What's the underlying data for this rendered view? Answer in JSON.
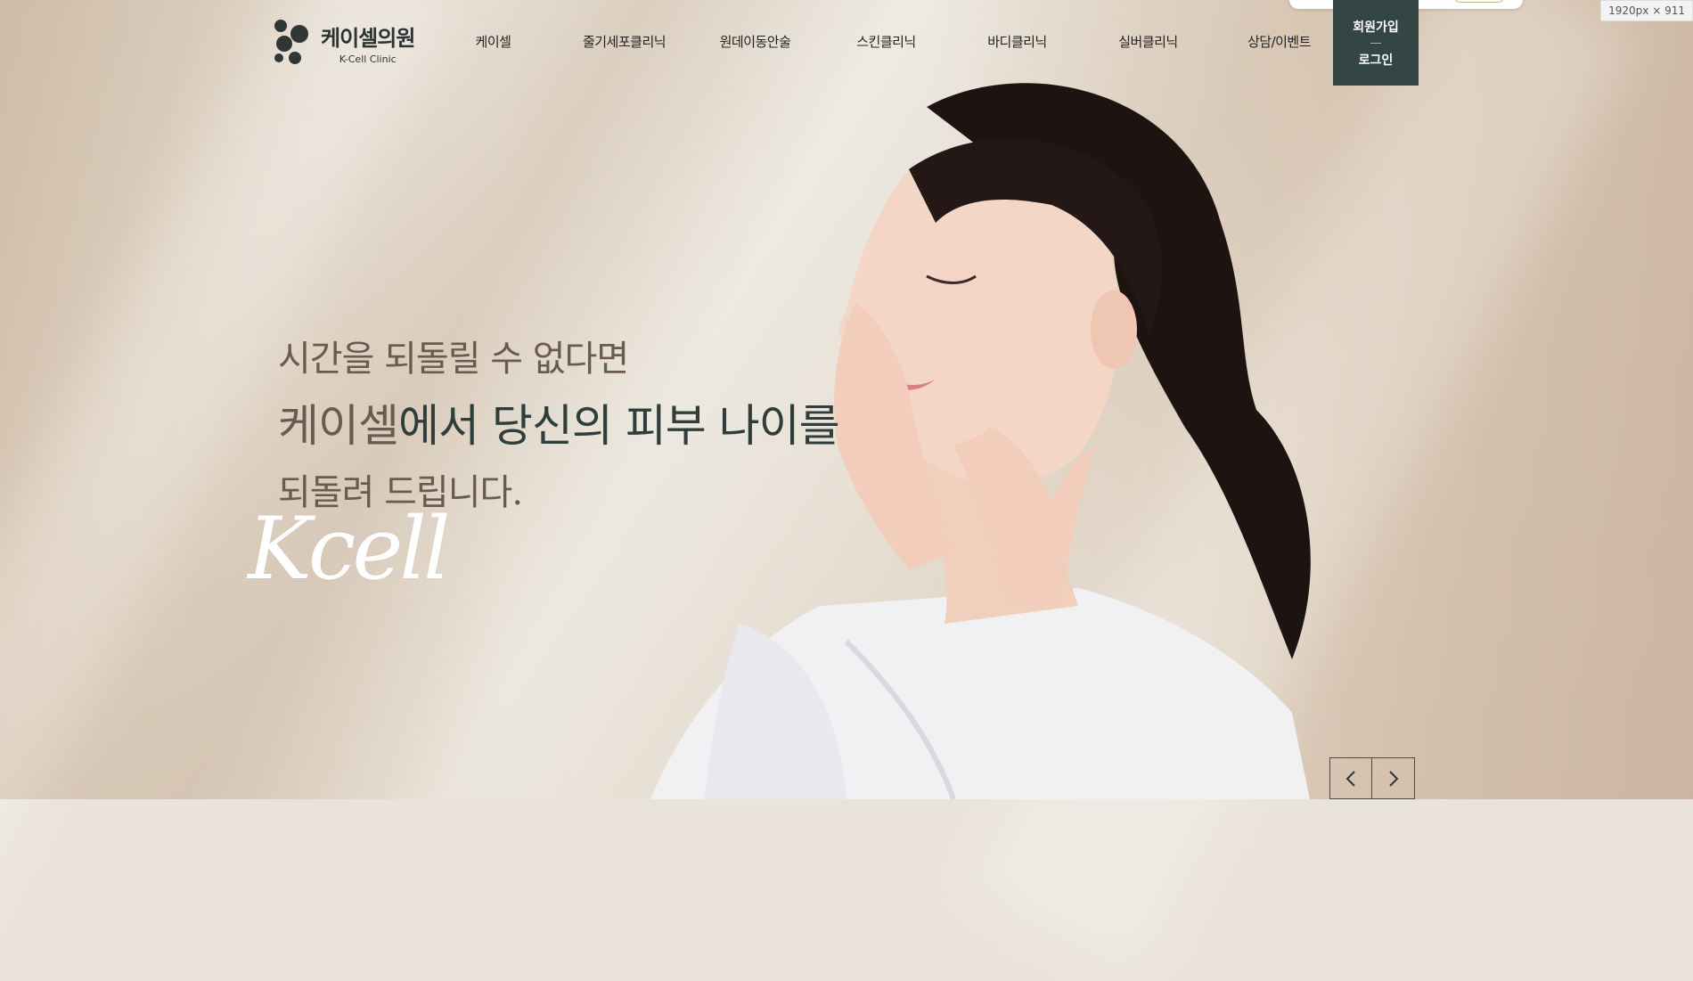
{
  "header": {
    "logo": {
      "name": "케이셀의원",
      "sub": "K-Cell Clinic"
    },
    "nav": [
      {
        "label": "케이셀"
      },
      {
        "label": "줄기세포클리닉"
      },
      {
        "label": "원데이동안술"
      },
      {
        "label": "스킨클리닉"
      },
      {
        "label": "바디클리닉"
      },
      {
        "label": "실버클리닉"
      },
      {
        "label": "상담/이벤트"
      }
    ],
    "member": {
      "signup": "회원가입",
      "sep": "—",
      "login": "로그인"
    }
  },
  "viewport_badge": "1920px × 911",
  "hero": {
    "line1": "시간을 되돌릴 수 없다면",
    "line2_a": "케이셀",
    "line2_b": "에서 당신의 피부 나이를",
    "line3": "되돌려 드립니다.",
    "script": "Kcell"
  },
  "slider": {
    "prev": "‹",
    "next": "›"
  },
  "colors": {
    "accent": "#334544",
    "text": "#2f3d3b",
    "muted": "#6b5a50"
  }
}
